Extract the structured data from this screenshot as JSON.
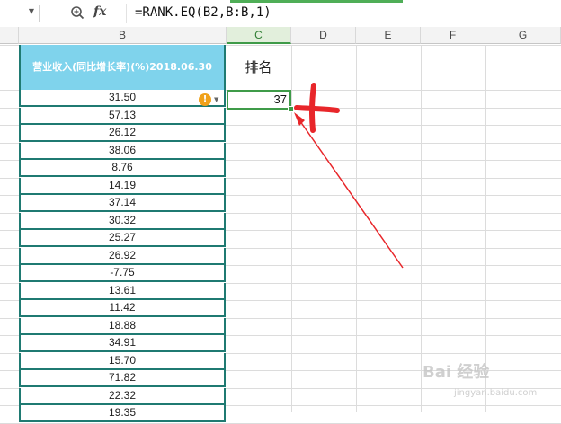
{
  "formula_bar": {
    "name_box_value": "",
    "zoom_icon": "magnifier-icon",
    "fx_label": "fx",
    "formula": "=RANK.EQ(B2,B:B,1)"
  },
  "columns": [
    "B",
    "C",
    "D",
    "E",
    "F",
    "G"
  ],
  "active_column": "C",
  "header_cell": "营业收入(同比增长率)(%)2018.06.30",
  "rank_header": "排名",
  "values": [
    "31.50",
    "57.13",
    "26.12",
    "38.06",
    "8.76",
    "14.19",
    "37.14",
    "30.32",
    "25.27",
    "26.92",
    "-7.75",
    "13.61",
    "11.42",
    "18.88",
    "34.91",
    "15.70",
    "71.82",
    "22.32",
    "19.35"
  ],
  "selected_value": "37",
  "warning_icon": "exclamation-icon",
  "accent_color": "#3f9b49",
  "header_fill_color": "#7fd3ec",
  "annotation_color": "#e8262a",
  "watermark": "Bai 经验",
  "watermark_url": "jingyan.baidu.com"
}
